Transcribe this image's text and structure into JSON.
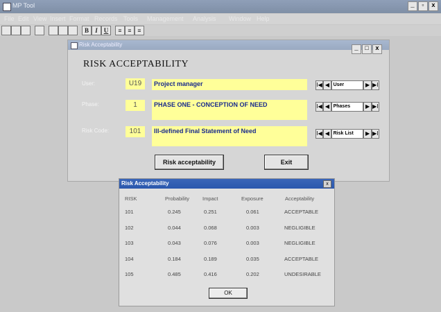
{
  "app": {
    "title": "MP Tool"
  },
  "window_controls": {
    "minimize": "_",
    "restore": "▫",
    "close": "x"
  },
  "menu": [
    {
      "label": "File"
    },
    {
      "label": "Edit"
    },
    {
      "label": "View"
    },
    {
      "label": "Insert"
    },
    {
      "label": "Format"
    },
    {
      "label": "Records"
    },
    {
      "label": "Tools"
    },
    {
      "label": "Management"
    },
    {
      "label": "Analysis"
    },
    {
      "label": "Window"
    },
    {
      "label": "Help"
    }
  ],
  "toolbar": [
    {
      "icon": "new-document-icon",
      "glyph": ""
    },
    {
      "icon": "open-folder-icon",
      "glyph": ""
    },
    {
      "icon": "save-icon",
      "glyph": ""
    },
    {
      "icon": "print-icon",
      "glyph": ""
    },
    {
      "icon": "cut-icon",
      "glyph": ""
    },
    {
      "icon": "copy-icon",
      "glyph": ""
    },
    {
      "icon": "paste-icon",
      "glyph": ""
    },
    {
      "icon": "bold-icon",
      "glyph": "B"
    },
    {
      "icon": "italic-icon",
      "glyph": "I"
    },
    {
      "icon": "underline-icon",
      "glyph": "U"
    },
    {
      "icon": "align-left-icon",
      "glyph": "≡"
    },
    {
      "icon": "align-center-icon",
      "glyph": "≡"
    },
    {
      "icon": "align-right-icon",
      "glyph": "≡"
    }
  ],
  "risk_window": {
    "title": "Risk Acceptability",
    "heading": "RISK ACCEPTABILITY",
    "controls": {
      "minimize": "_",
      "restore": "□",
      "close": "x"
    },
    "fields": [
      {
        "label": "User:",
        "code": "U19",
        "description": "Project manager",
        "navigator": "User"
      },
      {
        "label": "Phase:",
        "code": "1",
        "description": "PHASE ONE - CONCEPTION OF NEED",
        "navigator": "Phases"
      },
      {
        "label": "Risk Code:",
        "code": "101",
        "description": "Ill-defined Final Statement of Need",
        "navigator": "Risk List"
      }
    ],
    "nav_glyphs": {
      "first": "I◀",
      "prev": "◀",
      "next": "▶",
      "last": "▶I"
    },
    "buttons": {
      "risk_acceptability": "Risk acceptability",
      "exit": "Exit"
    }
  },
  "results_dialog": {
    "title": "Risk Acceptability",
    "close": "x",
    "columns": [
      "RISK",
      "Probability",
      "Impact",
      "Exposure",
      "Acceptability"
    ],
    "rows": [
      [
        "101",
        "0.245",
        "0.251",
        "0.061",
        "ACCEPTABLE"
      ],
      [
        "102",
        "0.044",
        "0.068",
        "0.003",
        "NEGLIGIBLE"
      ],
      [
        "103",
        "0.043",
        "0.076",
        "0.003",
        "NEGLIGIBLE"
      ],
      [
        "104",
        "0.184",
        "0.189",
        "0.035",
        "ACCEPTABLE"
      ],
      [
        "105",
        "0.485",
        "0.416",
        "0.202",
        "UNDESIRABLE"
      ]
    ],
    "ok_label": "OK"
  }
}
